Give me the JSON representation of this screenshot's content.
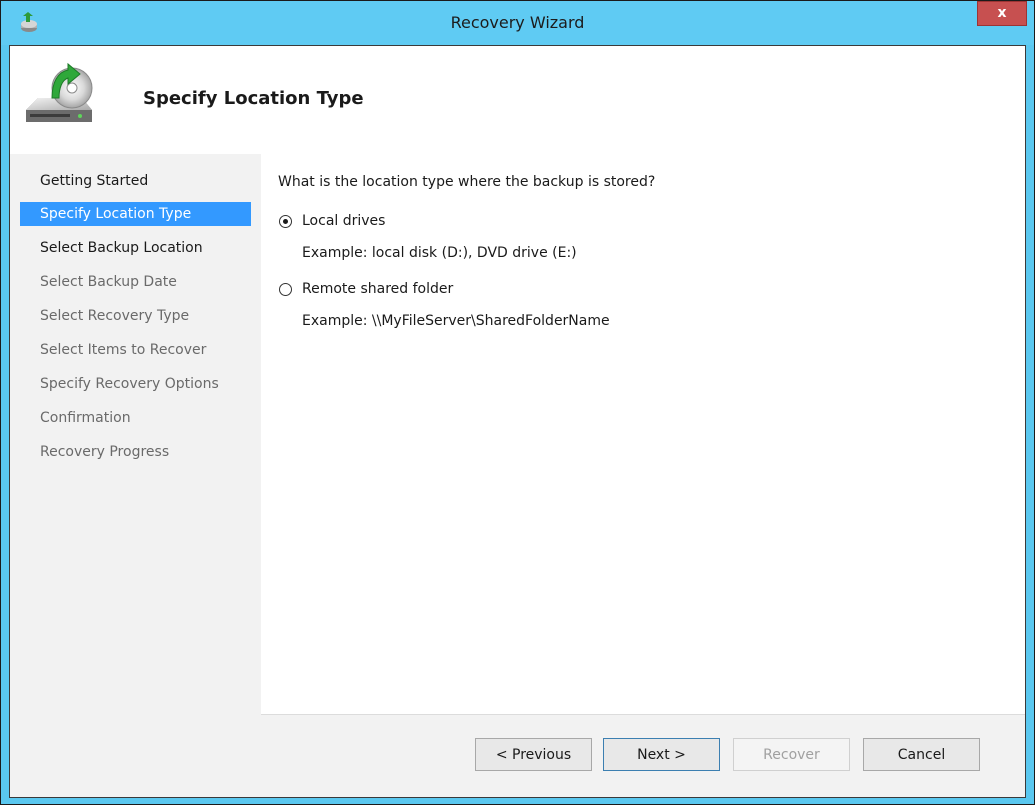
{
  "window": {
    "title": "Recovery Wizard",
    "close_label": "x"
  },
  "header": {
    "title": "Specify Location Type"
  },
  "nav": {
    "items": [
      {
        "label": "Getting Started",
        "state": "done"
      },
      {
        "label": "Specify Location Type",
        "state": "selected"
      },
      {
        "label": "Select Backup Location",
        "state": "current"
      },
      {
        "label": "Select Backup Date",
        "state": "pending"
      },
      {
        "label": "Select Recovery Type",
        "state": "pending"
      },
      {
        "label": "Select Items to Recover",
        "state": "pending"
      },
      {
        "label": "Specify Recovery Options",
        "state": "pending"
      },
      {
        "label": "Confirmation",
        "state": "pending"
      },
      {
        "label": "Recovery Progress",
        "state": "pending"
      }
    ]
  },
  "main": {
    "question": "What is the location type where the backup is stored?",
    "options": [
      {
        "label": "Local drives",
        "example": "Example: local disk (D:), DVD drive (E:)",
        "checked": true
      },
      {
        "label": "Remote shared folder",
        "example": "Example: \\\\MyFileServer\\SharedFolderName",
        "checked": false
      }
    ]
  },
  "footer": {
    "previous_label": "< Previous",
    "next_label": "Next >",
    "recover_label": "Recover",
    "cancel_label": "Cancel"
  },
  "colors": {
    "titlebar": "#5fcbf3",
    "selection": "#3399ff",
    "close": "#c75050"
  }
}
